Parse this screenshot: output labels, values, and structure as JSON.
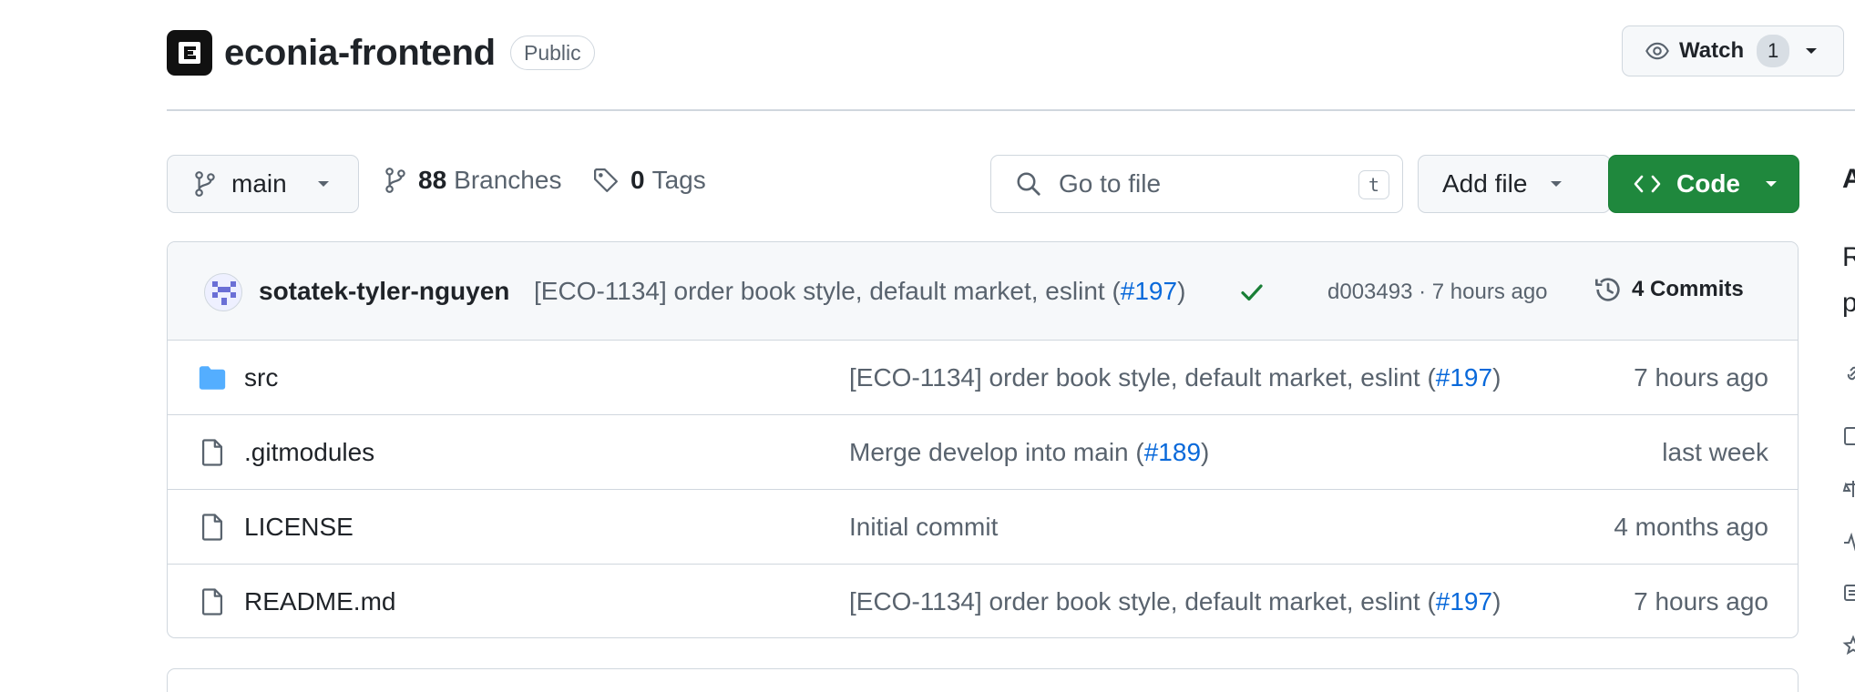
{
  "repo": {
    "name": "econia-frontend",
    "visibility": "Public",
    "logo_letter": "E"
  },
  "watch": {
    "label": "Watch",
    "count": "1"
  },
  "toolbar": {
    "branch": "main",
    "branches_count": "88",
    "branches_label": "Branches",
    "tags_count": "0",
    "tags_label": "Tags",
    "goto_placeholder": "Go to file",
    "goto_shortcut": "t",
    "add_file_label": "Add file",
    "code_label": "Code"
  },
  "sidebar_clip": {
    "heading_fragment": "A",
    "about_line1_fragment": "R",
    "about_line2_fragment": "p"
  },
  "latest_commit": {
    "author": "sotatek-tyler-nguyen",
    "message_prefix": "[ECO-1134] order book style, default market, eslint (",
    "pr": "#197",
    "message_suffix": ")",
    "sha": "d003493",
    "separator": " · ",
    "age": "7 hours ago",
    "commits_label": "4 Commits",
    "status": "success"
  },
  "files": [
    {
      "name": "src",
      "type": "folder",
      "msg_prefix": "[ECO-1134] order book style, default market, eslint (",
      "pr": "#197",
      "msg_suffix": ")",
      "age": "7 hours ago"
    },
    {
      "name": ".gitmodules",
      "type": "file",
      "msg_prefix": "Merge develop into main (",
      "pr": "#189",
      "msg_suffix": ")",
      "age": "last week"
    },
    {
      "name": "LICENSE",
      "type": "file",
      "msg_prefix": "Initial commit",
      "pr": "",
      "msg_suffix": "",
      "age": "4 months ago"
    },
    {
      "name": "README.md",
      "type": "file",
      "msg_prefix": "[ECO-1134] order book style, default market, eslint (",
      "pr": "#197",
      "msg_suffix": ")",
      "age": "7 hours ago"
    }
  ],
  "colors": {
    "accent_link": "#0969da",
    "code_button": "#1f883d",
    "folder": "#54aeff",
    "success": "#1a7f37"
  }
}
